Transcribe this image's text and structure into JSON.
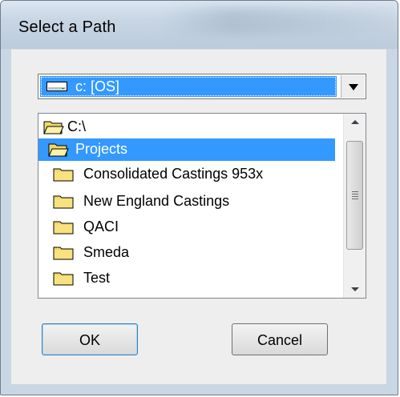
{
  "window": {
    "title": "Select a Path"
  },
  "drive_combo": {
    "selected": "c: [OS]",
    "icon": "drive-icon"
  },
  "folder_list": {
    "items": [
      {
        "label": "C:\\",
        "icon": "open-folder-icon",
        "selected": false
      },
      {
        "label": "Projects",
        "icon": "open-folder-icon",
        "selected": true
      },
      {
        "label": "Consolidated Castings 953x",
        "icon": "folder-icon",
        "selected": false
      },
      {
        "label": "New England Castings",
        "icon": "folder-icon",
        "selected": false
      },
      {
        "label": "QACI",
        "icon": "folder-icon",
        "selected": false
      },
      {
        "label": "Smeda",
        "icon": "folder-icon",
        "selected": false
      },
      {
        "label": "Test",
        "icon": "folder-icon",
        "selected": false
      }
    ]
  },
  "buttons": {
    "ok_label": "OK",
    "cancel_label": "Cancel"
  },
  "colors": {
    "selection": "#3399ff",
    "folder": "#f2d86a"
  }
}
